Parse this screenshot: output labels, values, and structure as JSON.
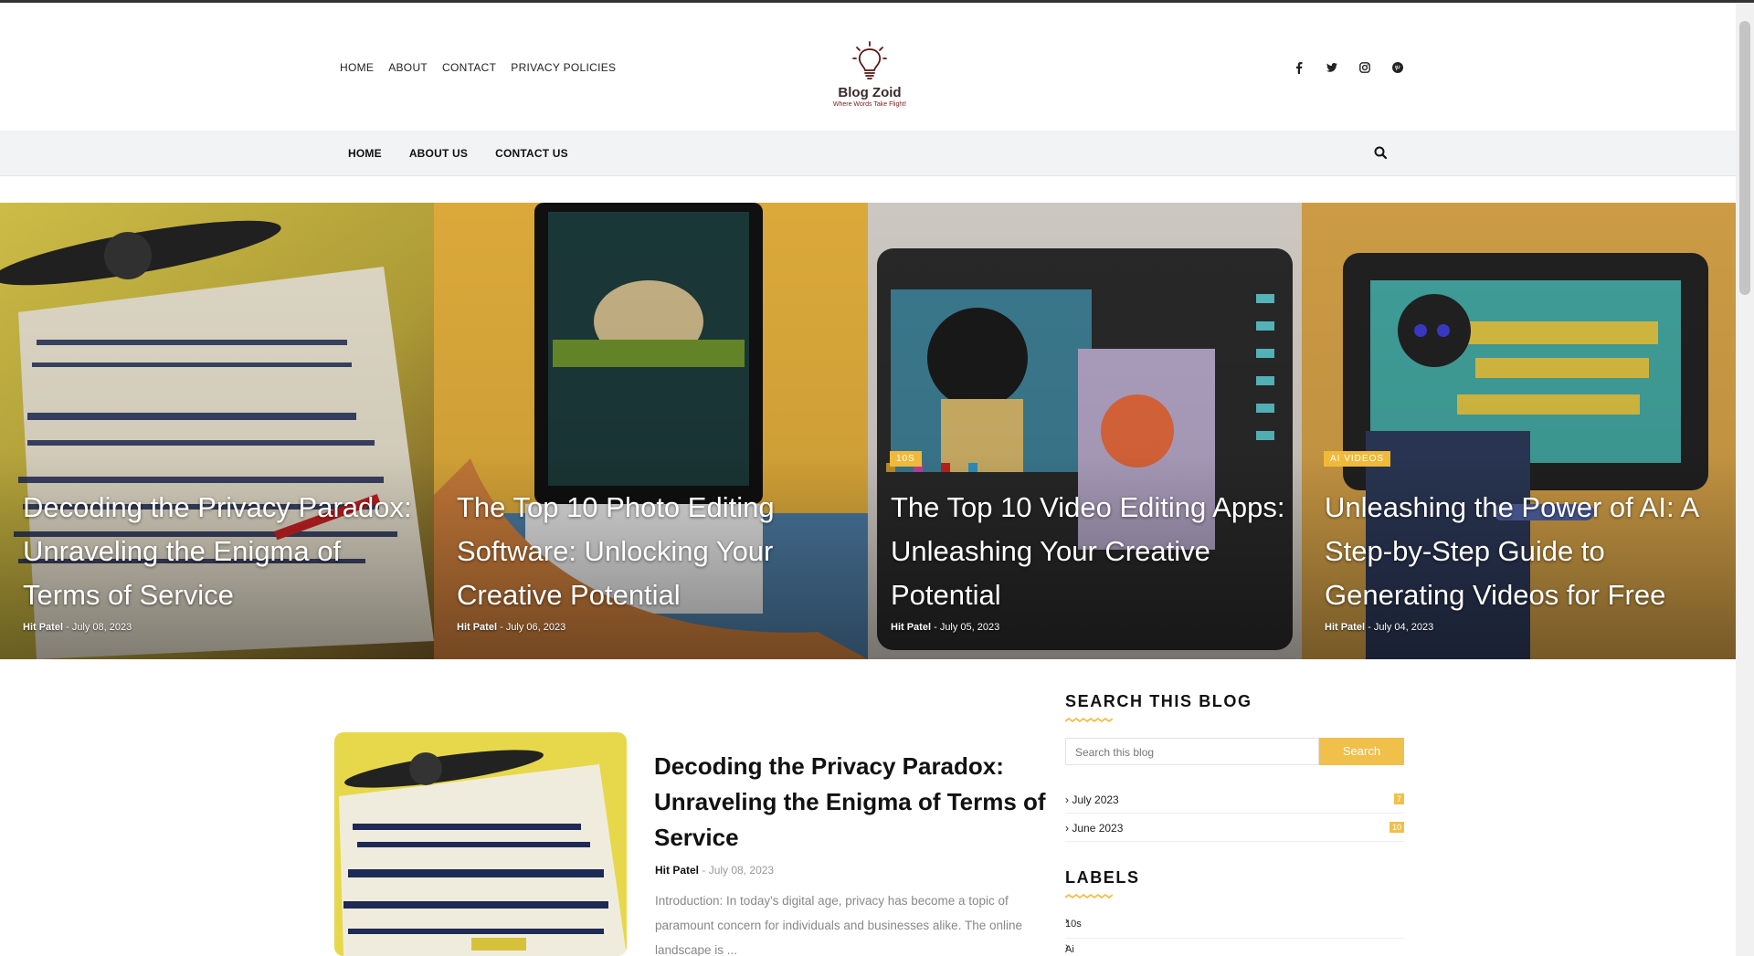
{
  "header": {
    "top_nav": [
      "HOME",
      "ABOUT",
      "CONTACT",
      "PRIVACY POLICIES"
    ],
    "logo_title": "Blog Zoid",
    "logo_tagline": "Where Words Take Flight!",
    "social_icons": [
      "facebook-icon",
      "twitter-icon",
      "instagram-icon",
      "pinterest-icon"
    ]
  },
  "main_nav": {
    "links": [
      "HOME",
      "ABOUT US",
      "CONTACT US"
    ],
    "search_icon": "search-icon"
  },
  "featured": [
    {
      "badge": "",
      "title": "Decoding the Privacy Paradox: Unraveling the Enigma of Terms of Service",
      "author": "Hit Patel",
      "separator": "-",
      "date": "July 08, 2023"
    },
    {
      "badge": "",
      "title": "The Top 10 Photo Editing Software: Unlocking Your Creative Potential",
      "author": "Hit Patel",
      "separator": "-",
      "date": "July 06, 2023"
    },
    {
      "badge": "10S",
      "title": "The Top 10 Video Editing Apps: Unleashing Your Creative Potential",
      "author": "Hit Patel",
      "separator": "-",
      "date": "July 05, 2023"
    },
    {
      "badge": "AI VIDEOS",
      "title": "Unleashing the Power of AI: A Step-by-Step Guide to Generating Videos for Free",
      "author": "Hit Patel",
      "separator": "-",
      "date": "July 04, 2023"
    }
  ],
  "post": {
    "title": "Decoding the Privacy Paradox: Unraveling the Enigma of Terms of Service",
    "author": "Hit Patel",
    "separator": "-",
    "date": "July 08, 2023",
    "excerpt": "Introduction: In today's digital age, privacy has become a topic of paramount concern for individuals and businesses alike. The online landscape is ..."
  },
  "sidebar": {
    "search_title": "SEARCH THIS BLOG",
    "search_placeholder": "Search this blog",
    "search_button": "Search",
    "archives": [
      {
        "label": "July 2023",
        "count": "7"
      },
      {
        "label": "June 2023",
        "count": "10"
      }
    ],
    "labels_title": "LABELS",
    "labels": [
      "10s",
      "Ai"
    ]
  },
  "colors": {
    "accent": "#f0c04b",
    "nav_bg": "#f2f3f4",
    "logo_brand": "#7a1a1a"
  }
}
